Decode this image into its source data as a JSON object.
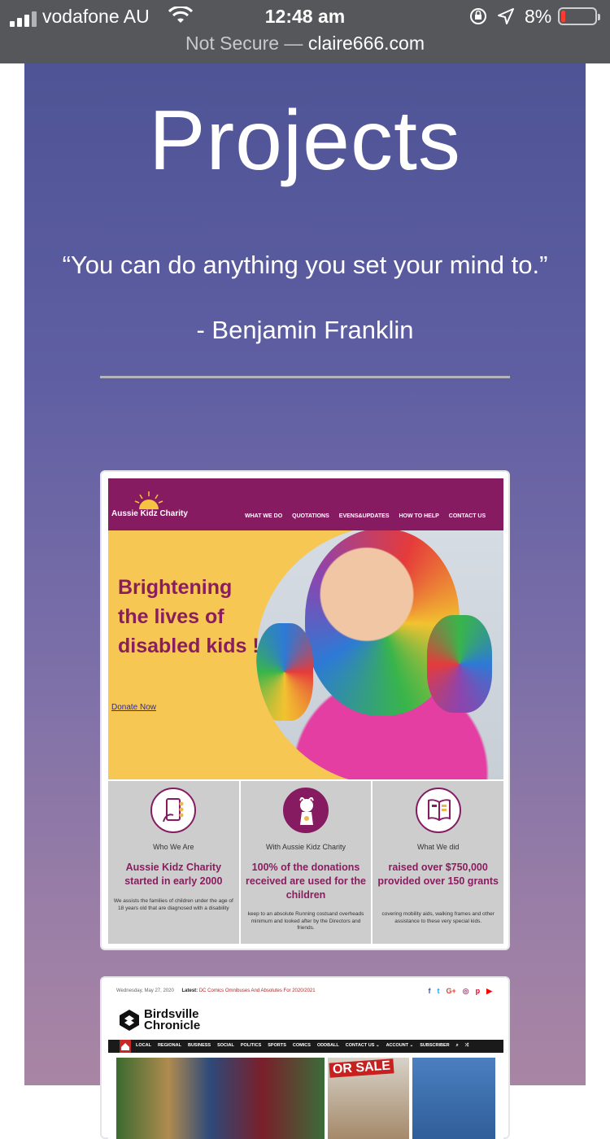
{
  "status_bar": {
    "carrier": "vodafone AU",
    "time": "12:48 am",
    "battery": "8%",
    "url_prefix": "Not Secure — ",
    "url": "claire666.com"
  },
  "page": {
    "title": "Projects",
    "quote": "“You can do anything you set your mind to.”",
    "author": "- Benjamin Franklin"
  },
  "project1": {
    "logo": "Aussie Kidz Charity",
    "menu": [
      "WHAT WE DO",
      "QUOTATIONS",
      "EVENS&UPDATES",
      "HOW TO HELP",
      "CONTACT US"
    ],
    "headline": "Brightening the lives of disabled kids !",
    "donate": "Donate Now",
    "columns": [
      {
        "sub": "Who We Are",
        "big": "Aussie Kidz Charity started in early 2000",
        "small": "We assists the families of children under the age of 18 years old that are diagnosed with a disability"
      },
      {
        "sub": "With Aussie Kidz Charity",
        "big": "100% of the donations received are used for the children",
        "small": "keep to an absolute Running costsand overheads minimum and looked after by the Directors and friends."
      },
      {
        "sub": "What We did",
        "big": "raised over $750,000 provided over 150 grants",
        "small": "covering mobility aids, walking frames and other assistance to these very special kids."
      }
    ]
  },
  "project2": {
    "date": "Wednesday, May 27, 2020",
    "latest_label": "Latest:",
    "latest_value": "DC Comics Omnibuses And Absolutes For 2020/2021",
    "logo_line1": "Birdsville",
    "logo_line2": "Chronicle",
    "menu": [
      "LOCAL",
      "REGIONAL",
      "BUSINESS",
      "SOCIAL",
      "POLITICS",
      "SPORTS",
      "COMICS",
      "ODDBALL",
      "CONTACT US ⌄",
      "ACCOUNT ⌄",
      "SUBSCRIBER"
    ],
    "sale": "OR SALE"
  },
  "colors": {
    "brand_purple": "#861b62",
    "hero_yellow": "#f6c752",
    "page_gradient_top": "#4e5495",
    "page_gradient_bottom": "#a985a4"
  }
}
